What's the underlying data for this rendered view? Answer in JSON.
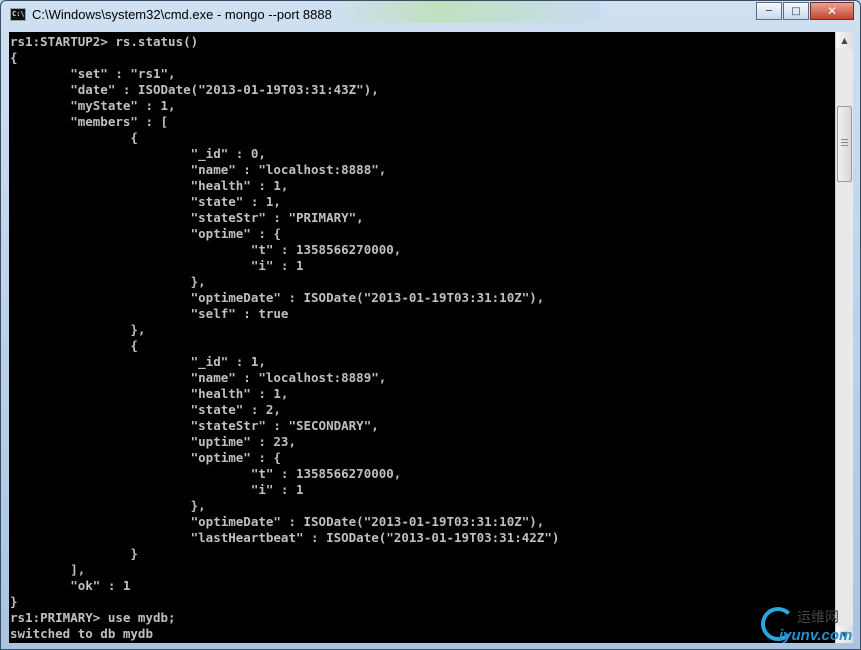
{
  "window": {
    "title": "C:\\Windows\\system32\\cmd.exe - mongo  --port 8888",
    "app_icon_text": "C:\\",
    "controls": {
      "minimize": "─",
      "maximize": "□",
      "close": "✕"
    }
  },
  "console": {
    "lines": [
      "rs1:STARTUP2> rs.status()",
      "{",
      "        \"set\" : \"rs1\",",
      "        \"date\" : ISODate(\"2013-01-19T03:31:43Z\"),",
      "        \"myState\" : 1,",
      "        \"members\" : [",
      "                {",
      "                        \"_id\" : 0,",
      "                        \"name\" : \"localhost:8888\",",
      "                        \"health\" : 1,",
      "                        \"state\" : 1,",
      "                        \"stateStr\" : \"PRIMARY\",",
      "                        \"optime\" : {",
      "                                \"t\" : 1358566270000,",
      "                                \"i\" : 1",
      "                        },",
      "                        \"optimeDate\" : ISODate(\"2013-01-19T03:31:10Z\"),",
      "                        \"self\" : true",
      "                },",
      "                {",
      "                        \"_id\" : 1,",
      "                        \"name\" : \"localhost:8889\",",
      "                        \"health\" : 1,",
      "                        \"state\" : 2,",
      "                        \"stateStr\" : \"SECONDARY\",",
      "                        \"uptime\" : 23,",
      "                        \"optime\" : {",
      "                                \"t\" : 1358566270000,",
      "                                \"i\" : 1",
      "                        },",
      "                        \"optimeDate\" : ISODate(\"2013-01-19T03:31:10Z\"),",
      "                        \"lastHeartbeat\" : ISODate(\"2013-01-19T03:31:42Z\")",
      "                }",
      "        ],",
      "        \"ok\" : 1",
      "}",
      "rs1:PRIMARY> use mydb;",
      "switched to db mydb"
    ]
  },
  "scrollbar": {
    "up_arrow": "▲",
    "down_arrow": "▼"
  },
  "watermark": {
    "cn_text": "运维网",
    "url": "iyunv.com"
  }
}
